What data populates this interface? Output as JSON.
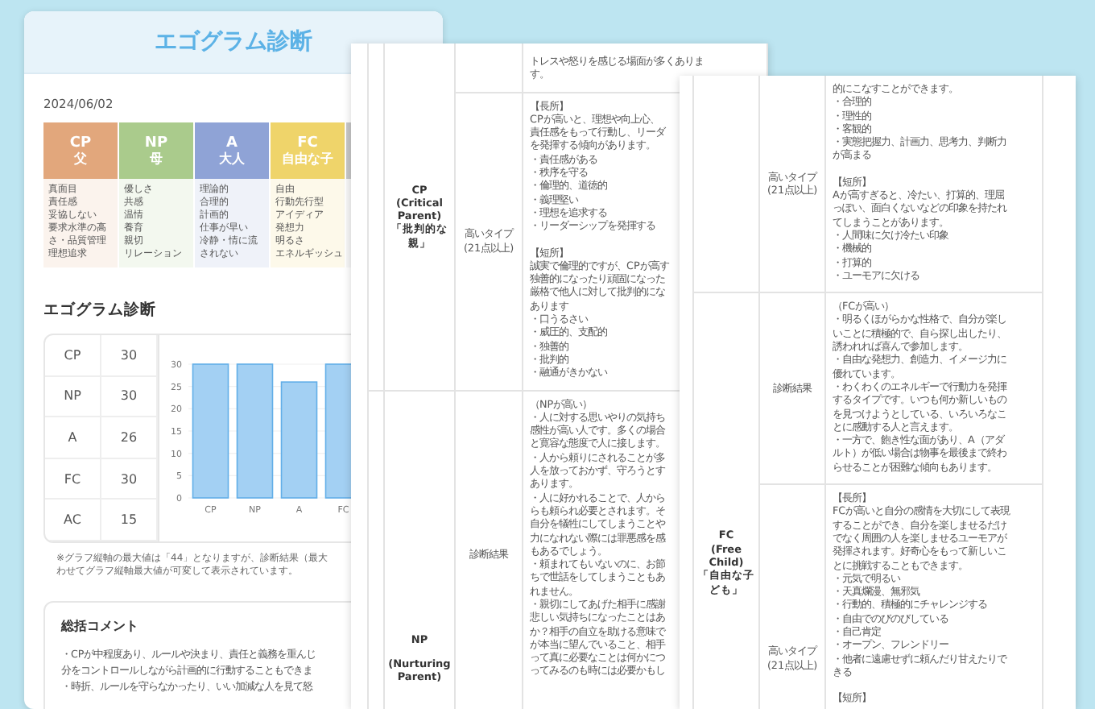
{
  "summary_page": {
    "title": "エゴグラム診断",
    "date": "2024/06/02",
    "types": [
      {
        "code": "CP",
        "role": "父",
        "color": "#e2a77c",
        "traits": [
          "真面目",
          "責任感",
          "妥協しない",
          "要求水準の高さ・品質管理",
          "理想追求"
        ]
      },
      {
        "code": "NP",
        "role": "母",
        "color": "#aacb8c",
        "traits": [
          "優しさ",
          "共感",
          "温情",
          "養育",
          "親切",
          "リレーション"
        ]
      },
      {
        "code": "A",
        "role": "大人",
        "color": "#8fa3d6",
        "traits": [
          "理論的",
          "合理的",
          "計画的",
          "仕事が早い",
          "冷静・情に流されない"
        ]
      },
      {
        "code": "FC",
        "role": "自由な子",
        "color": "#efd46a",
        "traits": [
          "自由",
          "行動先行型",
          "アイディア",
          "発想力",
          "明るさ",
          "エネルギッシュ"
        ]
      },
      {
        "color": "#c7c7c7"
      }
    ],
    "score_title": "エゴグラム診断",
    "scores": [
      {
        "label": "CP",
        "value": "30"
      },
      {
        "label": "NP",
        "value": "30"
      },
      {
        "label": "A",
        "value": "26"
      },
      {
        "label": "FC",
        "value": "30"
      },
      {
        "label": "AC",
        "value": "15"
      }
    ],
    "chart_data": {
      "type": "bar",
      "grid": true,
      "categories": [
        "CP",
        "NP",
        "A",
        "FC"
      ],
      "values": [
        30,
        30,
        26,
        30
      ],
      "ylim": [
        0,
        30
      ],
      "yticks": [
        0,
        5,
        10,
        15,
        20,
        25,
        30
      ]
    },
    "note": [
      "※グラフ縦軸の最大値は「44」となりますが、診断結果（最大",
      "わせてグラフ縦軸最大値が可変して表示されています。"
    ],
    "comment": {
      "title": "総括コメント",
      "lines": [
        "・CPが中程度あり、ルールや決まり、責任と義務を重んじ",
        "分をコントロールしながら計画的に行動することもできま",
        "・時折、ルールを守らなかったり、いい加減な人を見て怒"
      ]
    }
  },
  "detail_page_1": {
    "categories": [
      {
        "label": [
          [
            "CP",
            "(Critical",
            "Parent)",
            "「批判的な",
            "親」"
          ]
        ],
        "rows": [
          {
            "content": [
              [
                "トレスや怒りを感じる場面が多くありま",
                "す。"
              ]
            ]
          },
          {
            "type": [
              "高いタイプ",
              "(21点以上)"
            ],
            "content": [
              [
                "【長所】",
                "CPが高いと、理想や向上心、",
                "責任感をもって行動し、リーダ",
                "を発揮する傾向があります。",
                "・責任感がある",
                "・秩序を守る",
                "・倫理的、道徳的",
                "・義理堅い",
                "・理想を追求する",
                "・リーダーシップを発揮する"
              ],
              [
                "【短所】",
                "誠実で倫理的ですが、CPが高す",
                "独善的になったり頑固になった",
                "厳格で他人に対して批判的にな",
                "あります",
                "・口うるさい",
                "・威圧的、支配的",
                "・独善的",
                "・批判的",
                "・融通がきかない"
              ]
            ]
          }
        ]
      },
      {
        "label": [
          [
            "NP"
          ],
          [
            "(Nurturing",
            "Parent)"
          ]
        ],
        "rows": [
          {
            "type": [
              "診断結果"
            ],
            "content": [
              [
                "（NPが高い）",
                "・人に対する思いやりの気持ち",
                "感性が高い人です。多くの場合",
                "と寛容な態度で人に接します。",
                "・人から頼りにされることが多",
                "人を放っておかず、守ろうとす",
                "あります。",
                "・人に好かれることで、人から",
                "らも頼られ必要とされます。そ",
                "自分を犠牲にしてしまうことや",
                "力になれない際には罪悪感を感",
                "もあるでしょう。",
                "・頼まれてもいないのに、お節",
                "ちで世話をしてしまうこともあ",
                "れません。",
                "・親切にしてあげた相手に感謝",
                "悲しい気持ちになったことはあ",
                "か？相手の自立を助ける意味で",
                "が本当に望んでいること、相手",
                "って真に必要なことは何かにつ",
                "ってみるのも時には必要かもし"
              ]
            ]
          }
        ]
      }
    ]
  },
  "detail_page_2": {
    "categories": [
      {
        "rows": [
          {
            "type": [
              "高いタイプ",
              "(21点以上)"
            ],
            "content": [
              [
                "的にこなすことができます。",
                "・合理的",
                "・理性的",
                "・客観的",
                "・実態把握力、計画力、思考力、判断力",
                "が高まる"
              ],
              [
                "【短所】",
                "Aが高すぎると、冷たい、打算的、理屈",
                "っぽい、面白くないなどの印象を持たれ",
                "てしまうことがあります。",
                "・人間味に欠け冷たい印象",
                "・機械的",
                "・打算的",
                "・ユーモアに欠ける"
              ]
            ]
          }
        ]
      },
      {
        "label": [
          [
            "FC",
            "(Free",
            "Child)",
            "「自由な子",
            "ども」"
          ]
        ],
        "rows": [
          {
            "type": [
              "診断結果"
            ],
            "content": [
              [
                "（FCが高い）",
                "・明るくほがらかな性格で、自分が楽し",
                "いことに積極的で、自ら探し出したり、",
                "誘われれば喜んで参加します。",
                "・自由な発想力、創造力、イメージ力に",
                "優れています。",
                "・わくわくのエネルギーで行動力を発揮",
                "するタイプです。いつも何か新しいもの",
                "を見つけようとしている、いろいろなこ",
                "とに感動する人と言えます。",
                "・一方で、飽き性な面があり、A（アダ",
                "ルト）が低い場合は物事を最後まで終わ",
                "らせることが困難な傾向もあります。"
              ]
            ]
          },
          {
            "type": [
              "高いタイプ",
              "(21点以上)"
            ],
            "content": [
              [
                "【長所】",
                "FCが高いと自分の感情を大切にして表現",
                "することができ、自分を楽しませるだけ",
                "でなく周囲の人を楽しませるユーモアが",
                "発揮されます。好奇心をもって新しいこ",
                "とに挑戦することもできます。",
                "・元気で明るい",
                "・天真爛漫、無邪気",
                "・行動的、積極的にチャレンジする",
                "・自由でのびのびしている",
                "・自己肯定",
                "・オープン、フレンドリー",
                "・他者に遠慮せずに頼んだり甘えたりで",
                "きる"
              ],
              [
                "【短所】"
              ]
            ]
          }
        ]
      }
    ]
  }
}
